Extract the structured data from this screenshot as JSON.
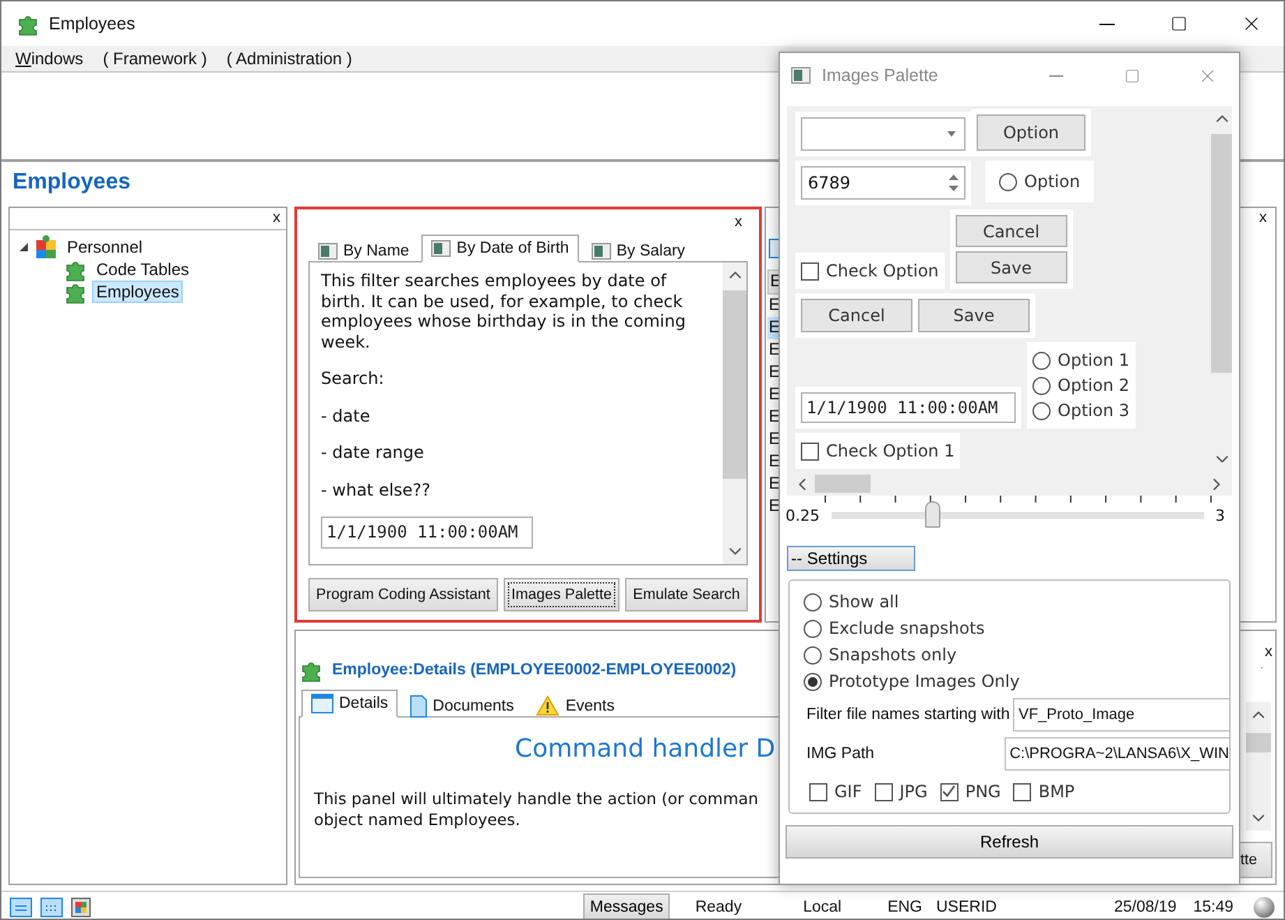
{
  "window": {
    "title": "Employees"
  },
  "menu": [
    {
      "label": "Windows",
      "underline_first": true
    },
    {
      "label": "( Framework )",
      "underline_first": false
    },
    {
      "label": "( Administration )",
      "underline_first": false
    }
  ],
  "page_heading": "Employees",
  "tree_panel": {
    "close": "x",
    "items": [
      {
        "label": "Personnel",
        "kind": "group",
        "expanded": true,
        "selected": false,
        "children": [
          {
            "label": "Code Tables",
            "kind": "leaf",
            "selected": false
          },
          {
            "label": "Employees",
            "kind": "leaf",
            "selected": true
          }
        ]
      }
    ]
  },
  "filter_panel": {
    "close": "x",
    "tabs": [
      {
        "label": "By Name",
        "selected": false
      },
      {
        "label": "By Date of Birth",
        "selected": true
      },
      {
        "label": "By Salary",
        "selected": false
      }
    ],
    "paragraphs": [
      "This filter searches employees by date of birth. It can be used, for example, to check employees whose birthday is in the coming week.",
      "Search:",
      "- date",
      "- date range",
      "- what else??"
    ],
    "date_value": "1/1/1900 11:00:00AM",
    "buttons": [
      {
        "label": "Program Coding Assistant",
        "focused": false
      },
      {
        "label": "Images Palette",
        "focused": true
      },
      {
        "label": "Emulate Search",
        "focused": false
      }
    ]
  },
  "list_panel": {
    "close": "x",
    "header": "E",
    "rows": [
      {
        "label": "E",
        "selected": false
      },
      {
        "label": "E",
        "selected": true
      },
      {
        "label": "E",
        "selected": false
      },
      {
        "label": "E",
        "selected": false
      },
      {
        "label": "E",
        "selected": false
      },
      {
        "label": "E",
        "selected": false
      },
      {
        "label": "E",
        "selected": false
      },
      {
        "label": "E",
        "selected": false
      },
      {
        "label": "E",
        "selected": false
      },
      {
        "label": "E",
        "selected": false
      }
    ]
  },
  "details_panel": {
    "close": "x",
    "title": "Employee:Details (EMPLOYEE0002-EMPLOYEE0002)",
    "tabs": [
      {
        "label": "Details",
        "kind": "window",
        "selected": true
      },
      {
        "label": "Documents",
        "kind": "document",
        "selected": false
      },
      {
        "label": "Events",
        "kind": "warning",
        "selected": false
      }
    ],
    "heading": "Command handler D",
    "body_lines": [
      "This panel will ultimately handle the action (or comman",
      "object named Employees."
    ],
    "button": "tte"
  },
  "palette": {
    "title": "Images Palette",
    "option_button": "Option",
    "spin_value": "6789",
    "radio_option": {
      "label": "Option",
      "selected": false
    },
    "stacked_buttons": [
      "Cancel",
      "Save"
    ],
    "check_option": {
      "label": "Check Option",
      "checked": false
    },
    "row_buttons": [
      "Cancel",
      "Save"
    ],
    "date_value": "1/1/1900 11:00:00AM",
    "radio_group": [
      {
        "label": "Option 1",
        "selected": false
      },
      {
        "label": "Option 2",
        "selected": false
      },
      {
        "label": "Option 3",
        "selected": false
      }
    ],
    "check_option_2": {
      "label": "Check Option 1",
      "checked": false
    },
    "slider": {
      "min_label": "0.25",
      "max_label": "3",
      "level": 0.27
    },
    "settings_button": "-- Settings",
    "filter_modes": [
      {
        "label": "Show all",
        "selected": false
      },
      {
        "label": "Exclude snapshots",
        "selected": false
      },
      {
        "label": "Snapshots only",
        "selected": false
      },
      {
        "label": "Prototype Images Only",
        "selected": true
      }
    ],
    "filter_prefix": {
      "label": "Filter file names starting with",
      "value": "VF_Proto_Image"
    },
    "img_path": {
      "label": "IMG Path",
      "value": "C:\\PROGRA~2\\LANSA6\\X_WIN"
    },
    "file_types": [
      {
        "label": "GIF",
        "checked": false
      },
      {
        "label": "JPG",
        "checked": false
      },
      {
        "label": "PNG",
        "checked": true
      },
      {
        "label": "BMP",
        "checked": false
      }
    ],
    "refresh_button": "Refresh"
  },
  "status_bar": {
    "messages_button": "Messages",
    "status": "Ready",
    "location": "Local",
    "language": "ENG",
    "user": "USERID",
    "date": "25/08/19",
    "time": "15:49"
  }
}
